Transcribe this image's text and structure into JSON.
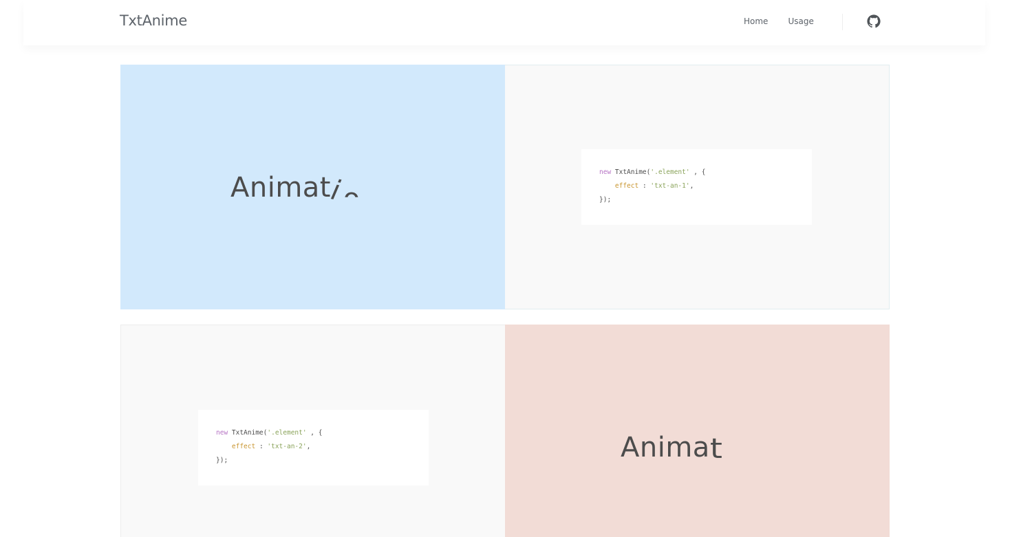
{
  "nav": {
    "brand": "TxtAnime",
    "links": [
      {
        "label": "Home"
      },
      {
        "label": "Usage"
      }
    ],
    "github_icon": "github-icon"
  },
  "demos": [
    {
      "preview": {
        "text_main": "Animat",
        "text_tail_1": "i",
        "text_tail_2": "o"
      },
      "code": {
        "keyword": "new",
        "call": " TxtAnime(",
        "selector": "'.element'",
        "open": " , {",
        "prop": "effect",
        "colon": " : ",
        "effect": "'txt-an-1'",
        "comma": ",",
        "close": "});"
      }
    },
    {
      "preview": {
        "text_main": "Anima",
        "text_tail_1": "t"
      },
      "code": {
        "keyword": "new",
        "call": " TxtAnime(",
        "selector": "'.element'",
        "open": " , {",
        "prop": "effect",
        "colon": " : ",
        "effect": "'txt-an-2'",
        "comma": ",",
        "close": "});"
      }
    }
  ],
  "colors": {
    "panel_blue": "#d2e9fc",
    "panel_pink": "#f2dcd6",
    "panel_grey": "#f9f9f9"
  }
}
